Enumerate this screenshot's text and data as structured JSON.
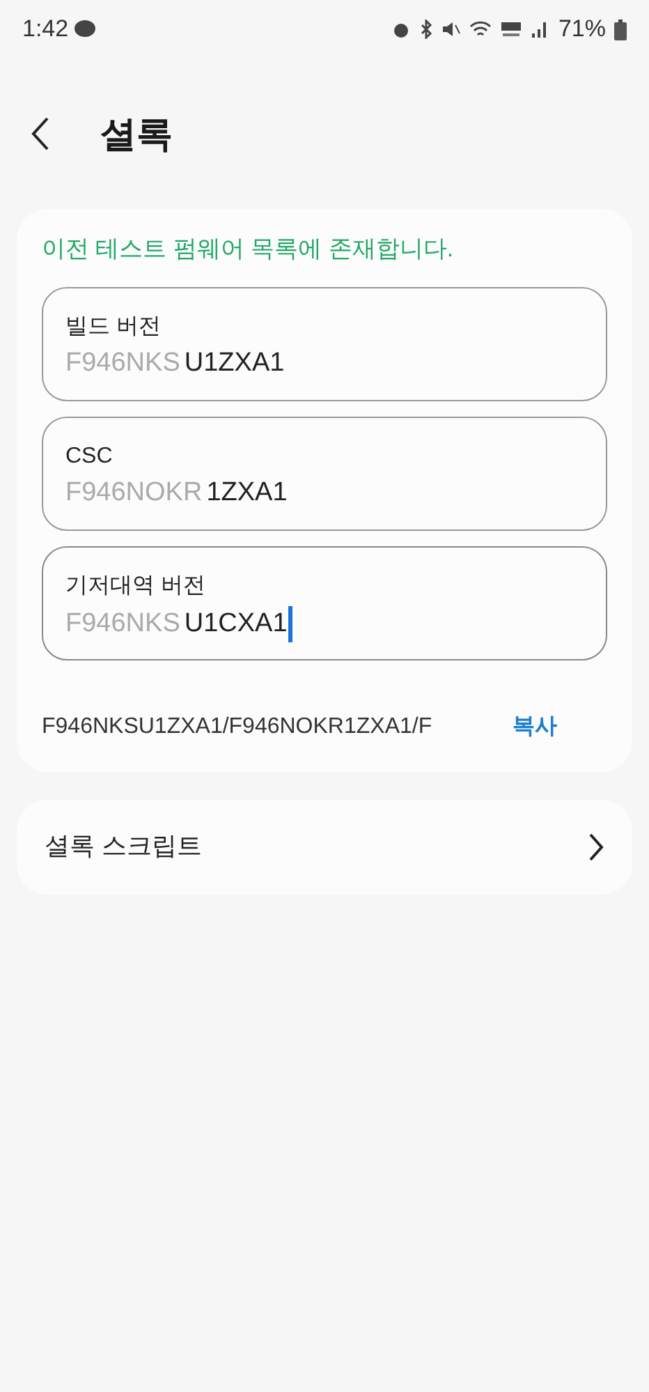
{
  "status_bar": {
    "time": "1:42",
    "battery": "71%"
  },
  "header": {
    "title": "셜록"
  },
  "card": {
    "notice": "이전 테스트 펌웨어 목록에 존재합니다.",
    "fields": [
      {
        "label": "빌드 버전",
        "prefix": "F946NKS",
        "value": "U1ZXA1",
        "focused": false
      },
      {
        "label": "CSC",
        "prefix": "F946NOKR",
        "value": "1ZXA1",
        "focused": false
      },
      {
        "label": "기저대역 버전",
        "prefix": "F946NKS",
        "value": "U1CXA1",
        "focused": true
      }
    ],
    "summary": "F946NKSU1ZXA1/F946NOKR1ZXA1/F",
    "copy": "복사"
  },
  "menu": {
    "label": "셜록 스크립트"
  }
}
